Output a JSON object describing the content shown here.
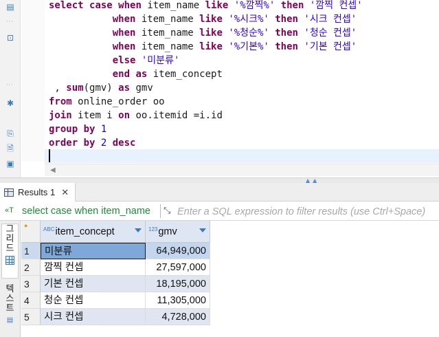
{
  "editor": {
    "code_lines": [
      [
        [
          "kw",
          "select "
        ],
        [
          "kw",
          "case "
        ],
        [
          "kw",
          "when "
        ],
        [
          "fn",
          "item_name "
        ],
        [
          "kw",
          "like "
        ],
        [
          "str",
          "'%깜찍%' "
        ],
        [
          "kw",
          "then "
        ],
        [
          "str",
          "'깜찍 컨셉'"
        ]
      ],
      [
        [
          "fn",
          "           "
        ],
        [
          "kw",
          "when "
        ],
        [
          "fn",
          "item_name "
        ],
        [
          "kw",
          "like "
        ],
        [
          "str",
          "'%시크%' "
        ],
        [
          "kw",
          "then "
        ],
        [
          "str",
          "'시크 컨셉'"
        ]
      ],
      [
        [
          "fn",
          "           "
        ],
        [
          "kw",
          "when "
        ],
        [
          "fn",
          "item_name "
        ],
        [
          "kw",
          "like "
        ],
        [
          "str",
          "'%청순%' "
        ],
        [
          "kw",
          "then "
        ],
        [
          "str",
          "'청순 컨셉'"
        ]
      ],
      [
        [
          "fn",
          "           "
        ],
        [
          "kw",
          "when "
        ],
        [
          "fn",
          "item_name "
        ],
        [
          "kw",
          "like "
        ],
        [
          "str",
          "'%기본%' "
        ],
        [
          "kw",
          "then "
        ],
        [
          "str",
          "'기본 컨셉'"
        ]
      ],
      [
        [
          "fn",
          "           "
        ],
        [
          "kw",
          "else "
        ],
        [
          "str",
          "'미분류'"
        ]
      ],
      [
        [
          "fn",
          "           "
        ],
        [
          "kw",
          "end "
        ],
        [
          "kw",
          "as "
        ],
        [
          "fn",
          "item_concept"
        ]
      ],
      [
        [
          "fn",
          " , "
        ],
        [
          "kw",
          "sum"
        ],
        [
          "fn",
          "(gmv) "
        ],
        [
          "kw",
          "as "
        ],
        [
          "fn",
          "gmv"
        ]
      ],
      [
        [
          "kw",
          "from "
        ],
        [
          "fn",
          "online_order oo"
        ]
      ],
      [
        [
          "kw",
          "join "
        ],
        [
          "fn",
          "item i "
        ],
        [
          "kw",
          "on "
        ],
        [
          "fn",
          "oo.itemid =i.id"
        ]
      ],
      [
        [
          "kw",
          "group "
        ],
        [
          "kw",
          "by "
        ],
        [
          "num",
          "1"
        ]
      ],
      [
        [
          "kw",
          "order "
        ],
        [
          "kw",
          "by "
        ],
        [
          "num",
          "2 "
        ],
        [
          "kw",
          "desc"
        ]
      ]
    ]
  },
  "results": {
    "tab_label": "Results 1",
    "close_glyph": "✕"
  },
  "filter": {
    "sql_label": "select case when item_name",
    "placeholder": "Enter a SQL expression to filter results (use Ctrl+Space)"
  },
  "side_tabs": {
    "grid_label": "그리드",
    "text_label": "텍스트"
  },
  "grid": {
    "columns": [
      {
        "type_badge": "ABC",
        "label": "item_concept"
      },
      {
        "type_badge": "123",
        "label": "gmv"
      }
    ],
    "rows": [
      {
        "num": "1",
        "item_concept": "미분류",
        "gmv": "64,949,000"
      },
      {
        "num": "2",
        "item_concept": "깜찍 컨셉",
        "gmv": "27,597,000"
      },
      {
        "num": "3",
        "item_concept": "기본 컨셉",
        "gmv": "18,195,000"
      },
      {
        "num": "4",
        "item_concept": "청순 컨셉",
        "gmv": "11,305,000"
      },
      {
        "num": "5",
        "item_concept": "시크 컨셉",
        "gmv": "4,728,000"
      }
    ]
  },
  "colors": {
    "keyword": "#7f0055",
    "string": "#2a00ff",
    "number": "#0000ff",
    "header_bg": "#dde6f2",
    "selected_cell": "#7da8d8"
  }
}
